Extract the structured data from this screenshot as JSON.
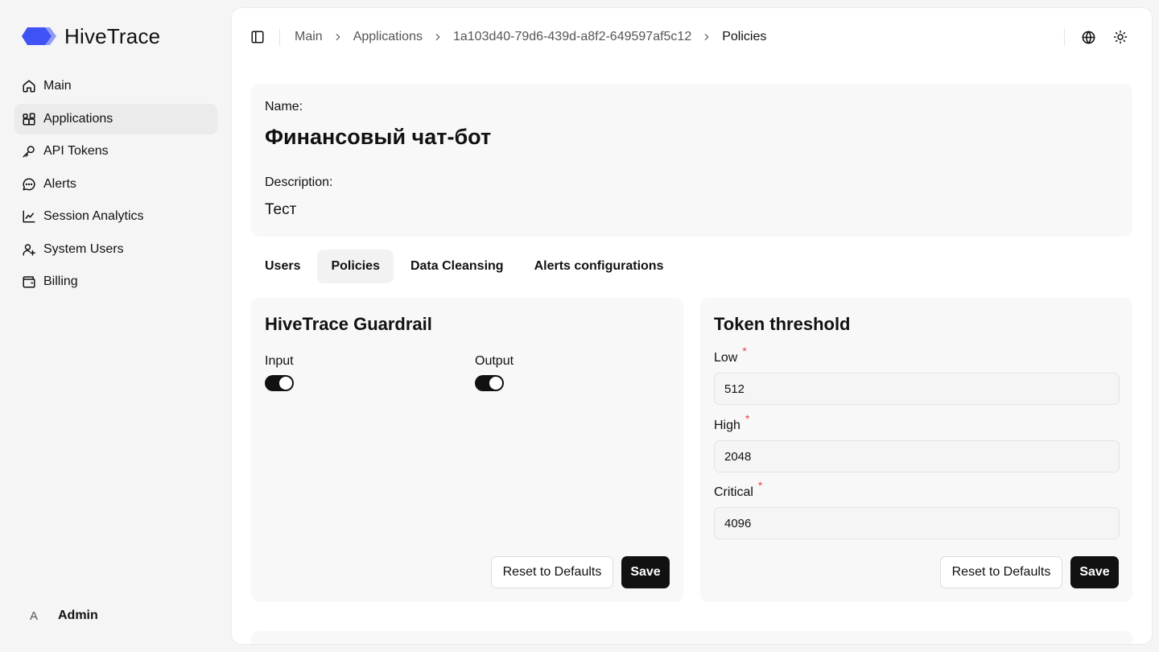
{
  "brand": {
    "name": "HiveTrace",
    "logo_color": "#3f52f5"
  },
  "nav": {
    "items": [
      {
        "label": "Main",
        "icon": "home-icon",
        "active": false
      },
      {
        "label": "Applications",
        "icon": "apps-icon",
        "active": true
      },
      {
        "label": "API Tokens",
        "icon": "key-icon",
        "active": false
      },
      {
        "label": "Alerts",
        "icon": "message-icon",
        "active": false
      },
      {
        "label": "Session Analytics",
        "icon": "chart-icon",
        "active": false
      },
      {
        "label": "System Users",
        "icon": "user-plus-icon",
        "active": false
      },
      {
        "label": "Billing",
        "icon": "wallet-icon",
        "active": false
      }
    ]
  },
  "user": {
    "initial": "A",
    "name": "Admin"
  },
  "breadcrumb": [
    "Main",
    "Applications",
    "1a103d40-79d6-439d-a8f2-649597af5c12",
    "Policies"
  ],
  "app": {
    "name_label": "Name:",
    "name": "Финансовый чат-бот",
    "description_label": "Description:",
    "description": "Тест"
  },
  "tabs": [
    {
      "label": "Users",
      "active": false
    },
    {
      "label": "Policies",
      "active": true
    },
    {
      "label": "Data Cleansing",
      "active": false
    },
    {
      "label": "Alerts configurations",
      "active": false
    }
  ],
  "guardrail": {
    "title": "HiveTrace Guardrail",
    "input_label": "Input",
    "input_on": true,
    "output_label": "Output",
    "output_on": true,
    "reset_label": "Reset to Defaults",
    "save_label": "Save"
  },
  "threshold": {
    "title": "Token threshold",
    "low_label": "Low",
    "low_value": "512",
    "high_label": "High",
    "high_value": "2048",
    "critical_label": "Critical",
    "critical_value": "4096",
    "required_mark": "*",
    "reset_label": "Reset to Defaults",
    "save_label": "Save"
  }
}
